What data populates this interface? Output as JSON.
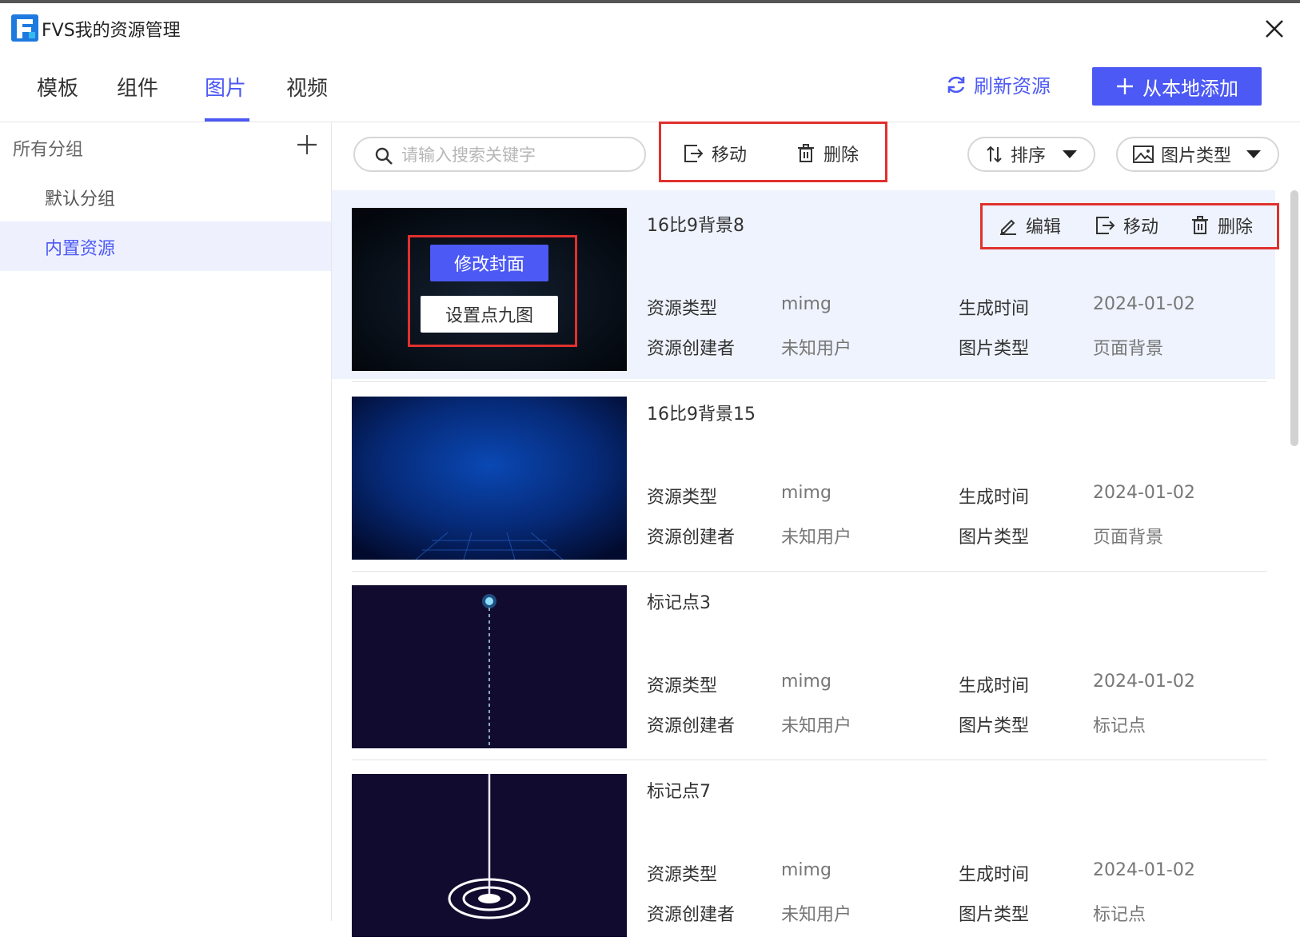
{
  "window": {
    "title": "FVS我的资源管理"
  },
  "tabs": [
    {
      "label": "模板",
      "active": false
    },
    {
      "label": "组件",
      "active": false
    },
    {
      "label": "图片",
      "active": true
    },
    {
      "label": "视频",
      "active": false
    }
  ],
  "header": {
    "refresh_label": "刷新资源",
    "add_label": "从本地添加"
  },
  "sidebar": {
    "heading": "所有分组",
    "items": [
      {
        "label": "默认分组",
        "active": false
      },
      {
        "label": "内置资源",
        "active": true
      }
    ]
  },
  "toolbar": {
    "search_placeholder": "请输入搜索关键字",
    "move_label": "移动",
    "delete_label": "删除",
    "sort_label": "排序",
    "image_type_label": "图片类型"
  },
  "hover_actions": {
    "edit_label": "编辑",
    "move_label": "移动",
    "delete_label": "删除",
    "change_cover_label": "修改封面",
    "nine_patch_label": "设置点九图"
  },
  "meta_labels": {
    "resource_type": "资源类型",
    "creator": "资源创建者",
    "created_time": "生成时间",
    "image_type": "图片类型"
  },
  "resources": [
    {
      "name": "16比9背景8",
      "resource_type": "mimg",
      "creator": "未知用户",
      "created_time": "2024-01-02",
      "image_type": "页面背景"
    },
    {
      "name": "16比9背景15",
      "resource_type": "mimg",
      "creator": "未知用户",
      "created_time": "2024-01-02",
      "image_type": "页面背景"
    },
    {
      "name": "标记点3",
      "resource_type": "mimg",
      "creator": "未知用户",
      "created_time": "2024-01-02",
      "image_type": "标记点"
    },
    {
      "name": "标记点7",
      "resource_type": "mimg",
      "creator": "未知用户",
      "created_time": "2024-01-02",
      "image_type": "标记点"
    }
  ],
  "colors": {
    "accent": "#4c59f4",
    "highlight_border": "#e0312e",
    "selected_bg": "#eef1fd"
  }
}
